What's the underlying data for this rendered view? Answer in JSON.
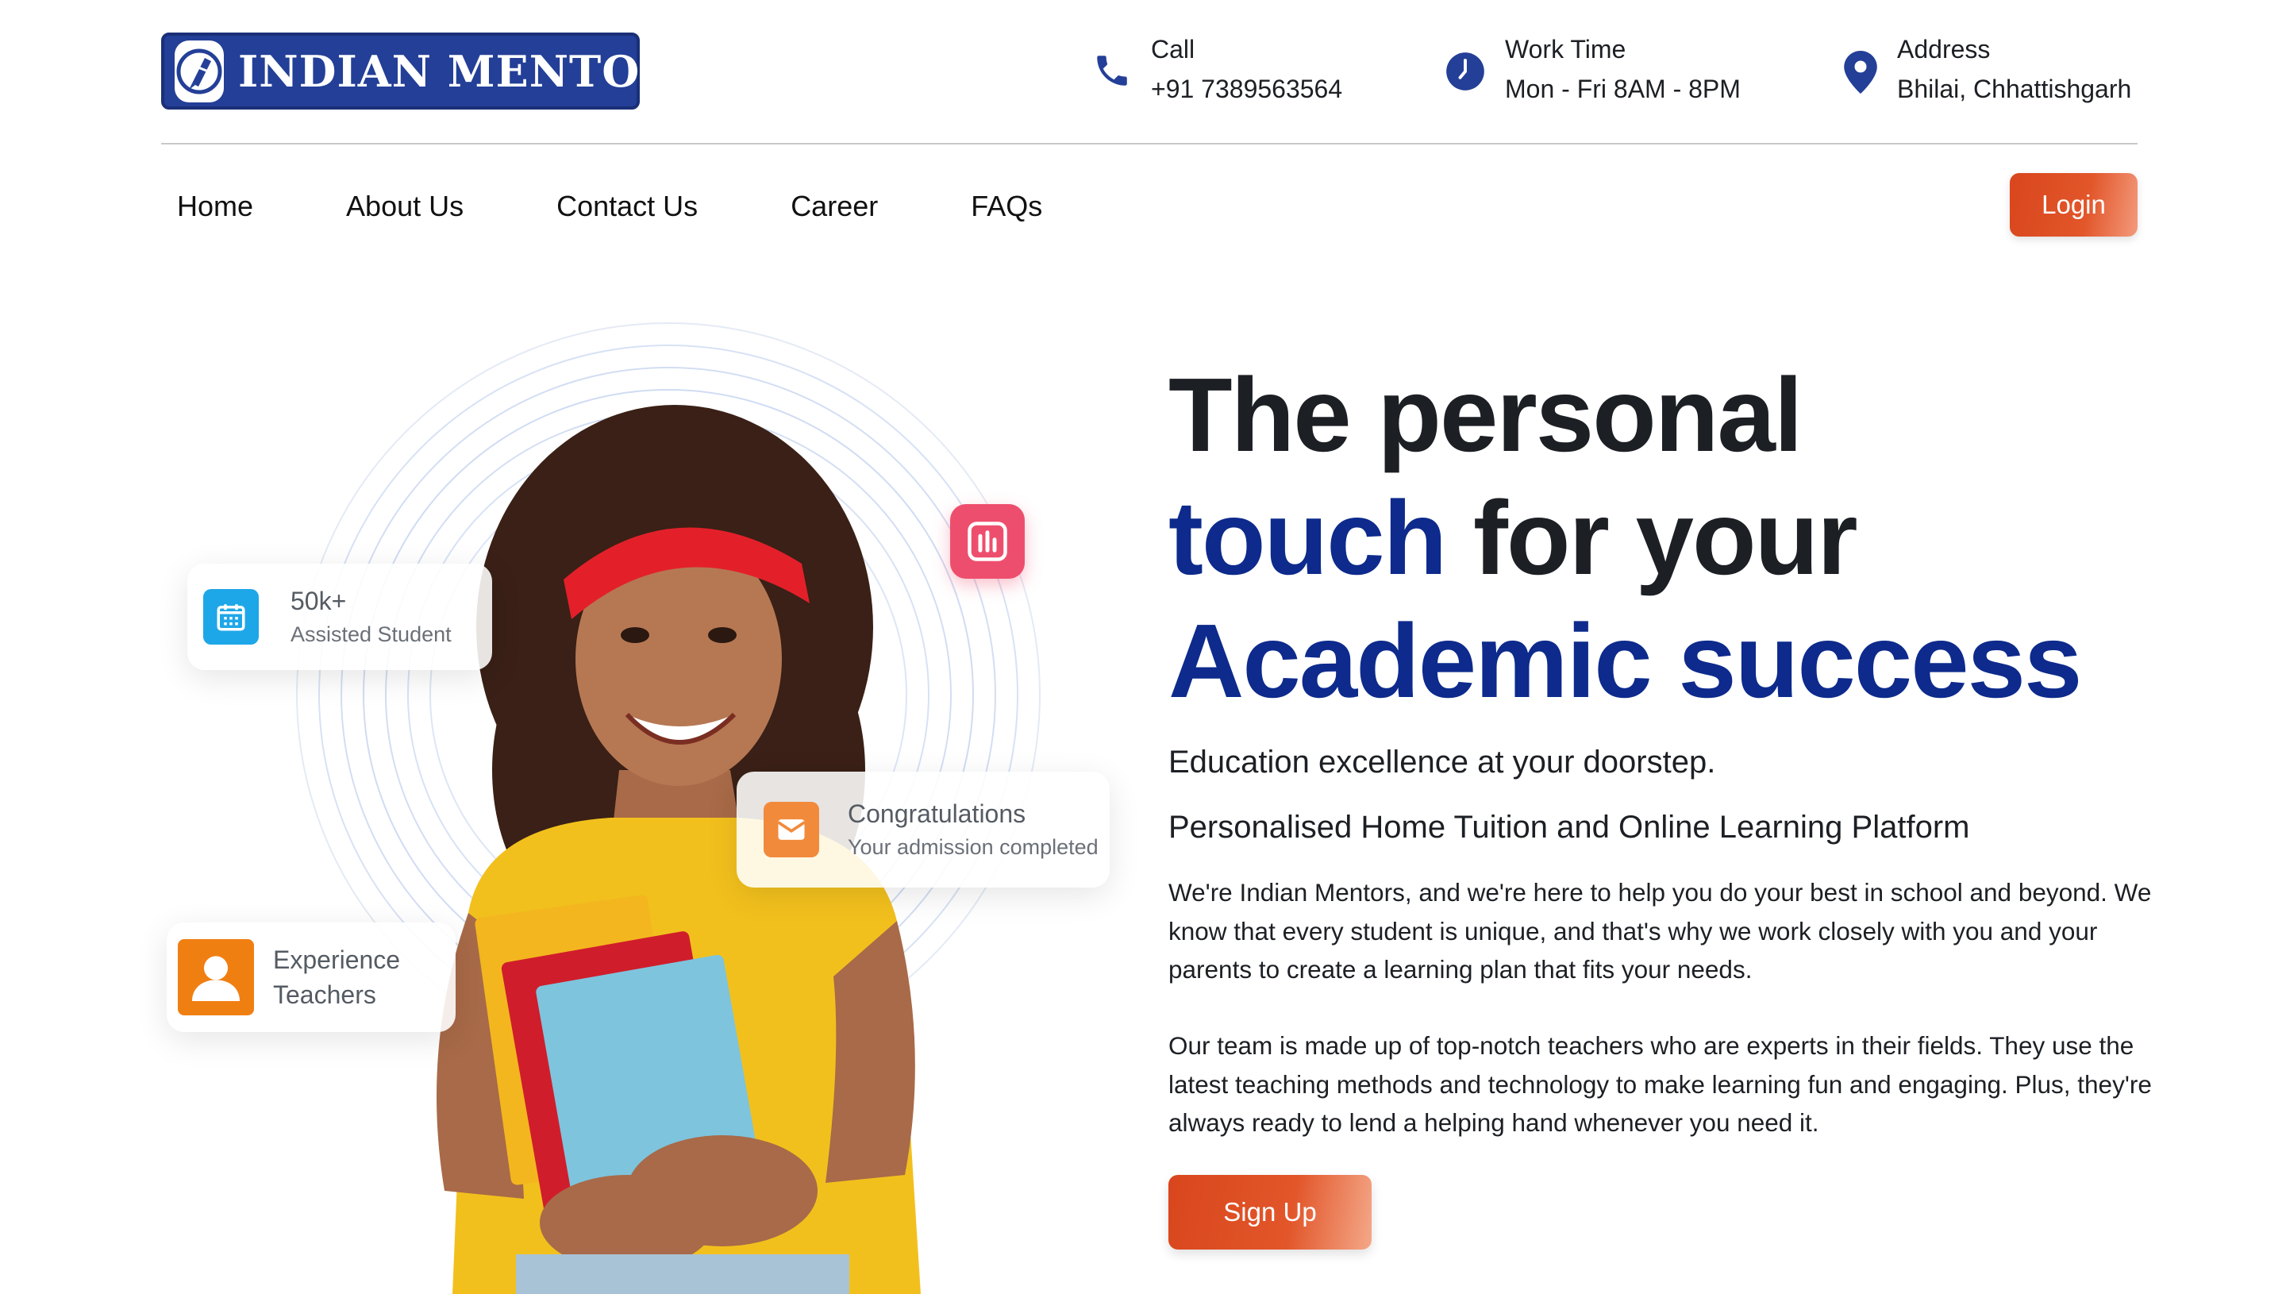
{
  "brand": {
    "name": "INDIAN MENTORS",
    "primary_color": "#233f97",
    "accent_color": "#e2562a",
    "heading_blue": "#0d2a8c"
  },
  "contacts": [
    {
      "label": "Call",
      "value": "+91 7389563564",
      "icon": "phone-icon"
    },
    {
      "label": "Work Time",
      "value": "Mon - Fri 8AM - 8PM",
      "icon": "clock-icon"
    },
    {
      "label": "Address",
      "value": "Bhilai, Chhattishgarh",
      "icon": "location-pin-icon"
    }
  ],
  "nav": {
    "items": [
      "Home",
      "About Us",
      "Contact Us",
      "Career",
      "FAQs"
    ],
    "login_label": "Login"
  },
  "hero": {
    "headline": {
      "line1": "The personal",
      "line2_highlight": "touch",
      "line2_rest": " for your",
      "line3": "Academic success"
    },
    "tagline": "Education excellence at your doorstep.",
    "subtitle": "Personalised Home Tuition and Online Learning Platform",
    "paragraphs": [
      "We're Indian Mentors, and we're here to help you do your best in school and beyond. We know that every student is unique, and that's why we work closely with you and your parents to create a learning plan that fits your needs.",
      "Our team is made up of top-notch teachers who are experts in their fields. They use the latest teaching methods and technology to make learning fun and engaging. Plus, they're always ready to lend a helping hand whenever you need it."
    ],
    "signup_label": "Sign Up"
  },
  "stat_cards": {
    "students": {
      "value": "50k+",
      "label": "Assisted Student",
      "icon": "calendar-icon",
      "color": "#1ea7e8"
    },
    "congrats": {
      "title": "Congratulations",
      "label": "Your admission completed",
      "icon": "envelope-icon",
      "color": "#f28a3c"
    },
    "teachers": {
      "line1": "Experience",
      "line2": "Teachers",
      "icon": "user-icon",
      "color": "#f07f12"
    },
    "chart_badge": {
      "icon": "bar-chart-icon",
      "color": "#ee4e6d"
    }
  }
}
